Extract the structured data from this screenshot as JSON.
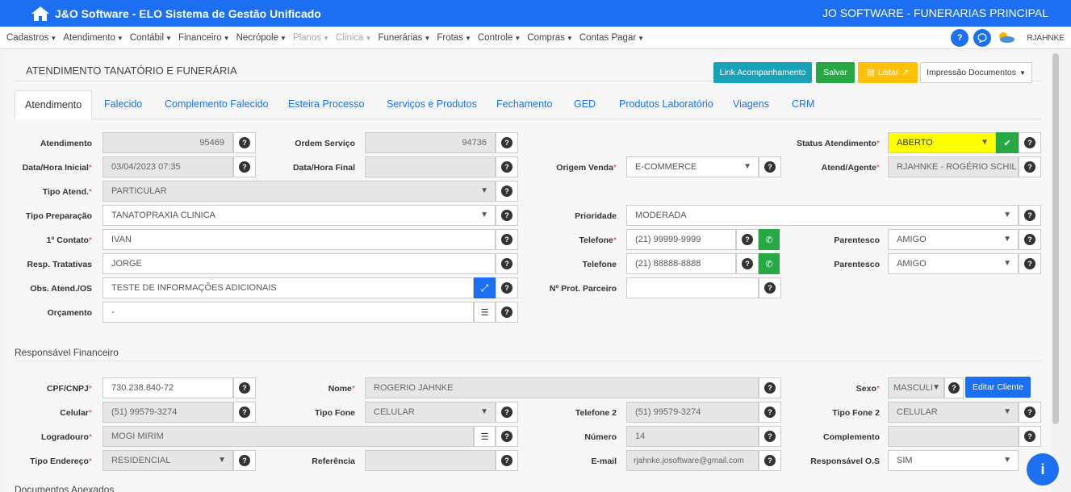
{
  "app": {
    "title": "J&O Software - ELO Sistema de Gestão Unificado",
    "company": "JO SOFTWARE - FUNERARIAS PRINCIPAL"
  },
  "menu": {
    "items": [
      "Cadastros",
      "Atendimento",
      "Contábil",
      "Financeiro",
      "Necrópole",
      "Planos",
      "Clinica",
      "Funerárias",
      "Frotas",
      "Controle",
      "Compras",
      "Contas Pagar"
    ],
    "user": "RJAHNKE"
  },
  "page": {
    "title": "ATENDIMENTO TANATÓRIO E FUNERÁRIA"
  },
  "actions": {
    "link": "Link Acompanhamento",
    "save": "Salvar",
    "list": "Listar",
    "print": "Impressão Documentos"
  },
  "tabs": [
    "Atendimento",
    "Falecido",
    "Complemento Falecido",
    "Esteira Processo",
    "Serviços e Produtos",
    "Fechamento",
    "GED",
    "Produtos Laboratório",
    "Viagens",
    "CRM"
  ],
  "form": {
    "atendimento": {
      "label": "Atendimento",
      "value": "95469"
    },
    "ordem_servico": {
      "label": "Ordem Serviço",
      "value": "94736"
    },
    "status": {
      "label": "Status Atendimento",
      "value": "ABERTO"
    },
    "data_inicial": {
      "label": "Data/Hora Inicial",
      "value": "03/04/2023 07:35"
    },
    "data_final": {
      "label": "Data/Hora Final",
      "value": ""
    },
    "origem_venda": {
      "label": "Origem Venda",
      "value": "E-COMMERCE"
    },
    "agente": {
      "label": "Atend/Agente",
      "value": "RJAHNKE - ROGÉRIO SCHIL"
    },
    "tipo_atend": {
      "label": "Tipo Atend.",
      "value": "PARTICULAR"
    },
    "tipo_prep": {
      "label": "Tipo Preparação",
      "value": "TANATOPRAXIA CLINICA"
    },
    "prioridade": {
      "label": "Prioridade",
      "value": "MODERADA"
    },
    "contato": {
      "label": "1º Contato",
      "value": "IVAN"
    },
    "telefone1": {
      "label": "Telefone",
      "value": "(21) 99999-9999"
    },
    "parentesco1": {
      "label": "Parentesco",
      "value": "AMIGO"
    },
    "resp_trat": {
      "label": "Resp. Tratativas",
      "value": "JORGE"
    },
    "telefone2": {
      "label": "Telefone",
      "value": "(21) 88888-8888"
    },
    "parentesco2": {
      "label": "Parentesco",
      "value": "AMIGO"
    },
    "obs": {
      "label": "Obs. Atend./OS",
      "value": "TESTE DE INFORMAÇÕES ADICIONAIS"
    },
    "prot_parceiro": {
      "label": "Nº Prot. Parceiro",
      "value": ""
    },
    "orcamento": {
      "label": "Orçamento",
      "value": "-"
    }
  },
  "responsavel": {
    "section": "Responsável Financeiro",
    "cpf": {
      "label": "CPF/CNPJ",
      "value": "730.238.840-72"
    },
    "nome": {
      "label": "Nome",
      "value": "ROGERIO JAHNKE"
    },
    "sexo": {
      "label": "Sexo",
      "value": "MASCULI"
    },
    "edit_button": "Editar Cliente",
    "celular": {
      "label": "Celular",
      "value": "(51) 99579-3274"
    },
    "tipo_fone": {
      "label": "Tipo Fone",
      "value": "CELULAR"
    },
    "telefone2": {
      "label": "Telefone 2",
      "value": "(51) 99579-3274"
    },
    "tipo_fone2": {
      "label": "Tipo Fone 2",
      "value": "CELULAR"
    },
    "logradouro": {
      "label": "Logradouro",
      "value": "MOGI MIRIM"
    },
    "numero": {
      "label": "Número",
      "value": "14"
    },
    "complemento": {
      "label": "Complemento",
      "value": ""
    },
    "tipo_endereco": {
      "label": "Tipo Endereço",
      "value": "RESIDENCIAL"
    },
    "referencia": {
      "label": "Referência",
      "value": ""
    },
    "email": {
      "label": "E-mail",
      "value": "rjahnke.josoftware@gmail.com"
    },
    "resp_os": {
      "label": "Responsável O.S",
      "value": "SIM"
    }
  },
  "bottom_section": "Documentos Anexados",
  "colors": {
    "primary": "#1d6ff2",
    "success": "#28a745",
    "warning": "#ffc107",
    "teal": "#17a2b8",
    "status_bg": "#ffff00"
  }
}
